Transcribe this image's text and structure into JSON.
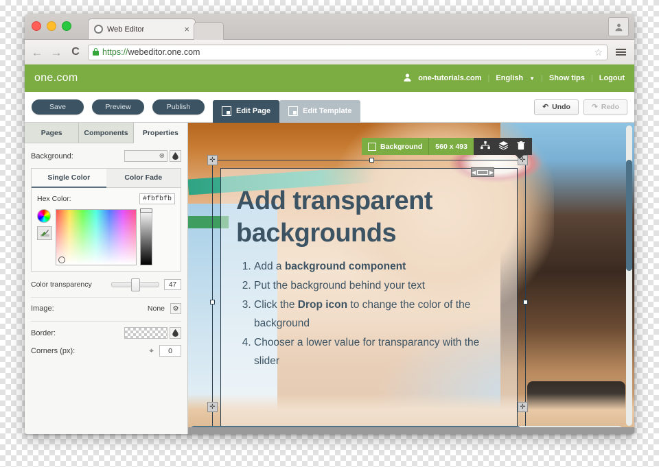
{
  "browser": {
    "tab_title": "Web Editor",
    "tab_close": "×",
    "nav_back": "←",
    "nav_forward": "→",
    "nav_reload": "C",
    "url_scheme": "https://",
    "url_rest": "webeditor.one.com",
    "star_icon": "☆",
    "favicon_name": "web-editor-favicon"
  },
  "appbar": {
    "logo": "one.com",
    "account": "one-tutorials.com",
    "language": "English",
    "language_caret": "▼",
    "show_tips": "Show tips",
    "logout": "Logout",
    "sep": "|",
    "person_icon": "👤"
  },
  "toolbar": {
    "save": "Save",
    "preview": "Preview",
    "publish": "Publish",
    "edit_page": "Edit Page",
    "edit_template": "Edit Template",
    "undo": "Undo",
    "undo_icon": "↶",
    "redo": "Redo",
    "redo_icon": "↷"
  },
  "sidebar": {
    "tabs": [
      {
        "label": "Pages"
      },
      {
        "label": "Components"
      },
      {
        "label": "Properties"
      }
    ],
    "background": {
      "label": "Background:",
      "clear_icon": "⊗"
    },
    "picker": {
      "tabs": [
        {
          "label": "Single Color"
        },
        {
          "label": "Color Fade"
        }
      ],
      "hex_label": "Hex Color:",
      "hex_value": "#fbfbfb"
    },
    "transparency": {
      "label": "Color transparency",
      "value": "47"
    },
    "image": {
      "label": "Image:",
      "value": "None",
      "gear_icon": "⚙"
    },
    "border": {
      "label": "Border:"
    },
    "corners": {
      "label": "Corners (px):",
      "value": "0",
      "icon": "⌖"
    }
  },
  "canvas": {
    "selection": {
      "name": "Background",
      "size": "560 x 493",
      "align_icon": "⁂",
      "layers_icon": "▤",
      "delete_icon": "🗑",
      "width_left_arrow": "◀",
      "width_right_arrow": "▶",
      "move_icon": "✛"
    },
    "heading": "Add transparent backgrounds",
    "steps": [
      {
        "pre": "Add a ",
        "bold": "background component",
        "post": ""
      },
      {
        "pre": "Put the background behind your text",
        "bold": "",
        "post": ""
      },
      {
        "pre": "Click the ",
        "bold": "Drop icon",
        "post": " to change the color of the background"
      },
      {
        "pre": "Chooser a lower value for transparancy with the slider",
        "bold": "",
        "post": ""
      }
    ]
  },
  "colors": {
    "brand_green": "#7cad42",
    "dark_slate": "#3c5363",
    "scroll_thumb": "#4d7287"
  }
}
